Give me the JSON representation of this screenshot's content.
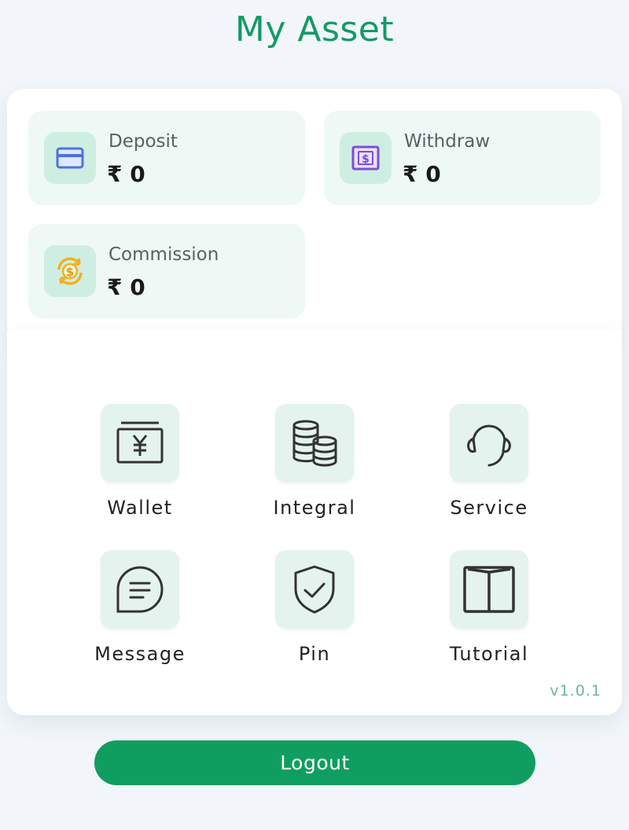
{
  "header": {
    "title": "My Asset"
  },
  "assets": [
    {
      "label": "Deposit",
      "amount": "₹ 0",
      "icon": "card-icon"
    },
    {
      "label": "Withdraw",
      "amount": "₹ 0",
      "icon": "cash-icon"
    },
    {
      "label": "Commission",
      "amount": "₹ 0",
      "icon": "exchange-dollar-icon"
    }
  ],
  "menu": [
    {
      "label": "Wallet",
      "icon": "wallet-yen-icon"
    },
    {
      "label": "Integral",
      "icon": "coins-icon"
    },
    {
      "label": "Service",
      "icon": "headset-icon"
    },
    {
      "label": "Message",
      "icon": "chat-icon"
    },
    {
      "label": "Pin",
      "icon": "shield-check-icon"
    },
    {
      "label": "Tutorial",
      "icon": "book-icon"
    }
  ],
  "version": "v1.0.1",
  "logout_label": "Logout",
  "colors": {
    "accent": "#149a63",
    "button": "#0f9e5f",
    "tile_bg": "#e4f3ee",
    "asset_bg": "#eef8f4"
  }
}
